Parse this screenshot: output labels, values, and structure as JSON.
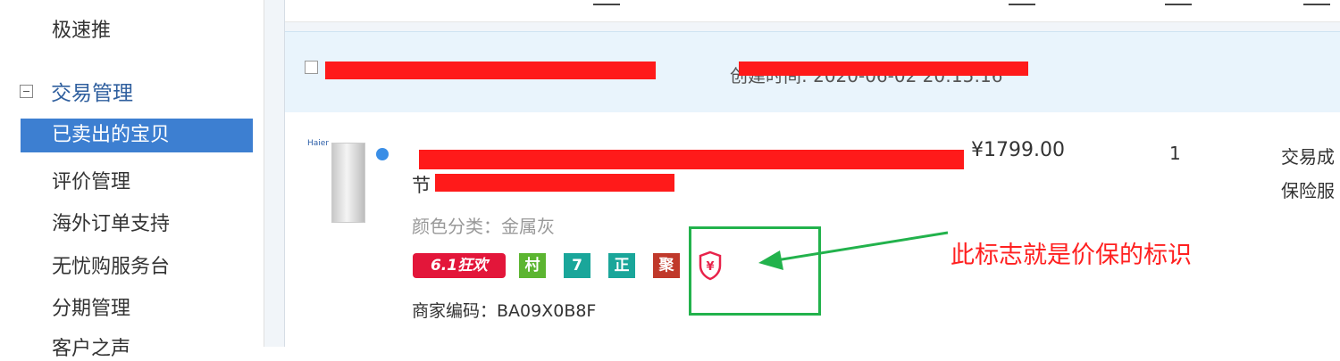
{
  "sidebar": {
    "items_top": [
      "极速推"
    ],
    "group": "交易管理",
    "items": [
      "已卖出的宝贝",
      "评价管理",
      "海外订单支持",
      "无忧购服务台",
      "分期管理",
      "客户之声"
    ]
  },
  "order": {
    "time": "创建时间: 2020-06-02 20:15:16",
    "title_start": "节",
    "attr": "颜色分类：金属灰",
    "price": "¥1799.00",
    "qty": "1",
    "status_line1": "交易成",
    "status_line2": "保险服",
    "sku": "商家编码：BA09X0B8F",
    "tags": [
      "6.1狂欢",
      "村",
      "7",
      "正",
      "聚"
    ],
    "brand_logo": "Haier"
  },
  "annotation": {
    "text": "此标志就是价保的标识",
    "color": "#ff2020",
    "box_color": "#22b24c"
  },
  "icons": {
    "price_protect": "price-protection-shield-icon"
  }
}
